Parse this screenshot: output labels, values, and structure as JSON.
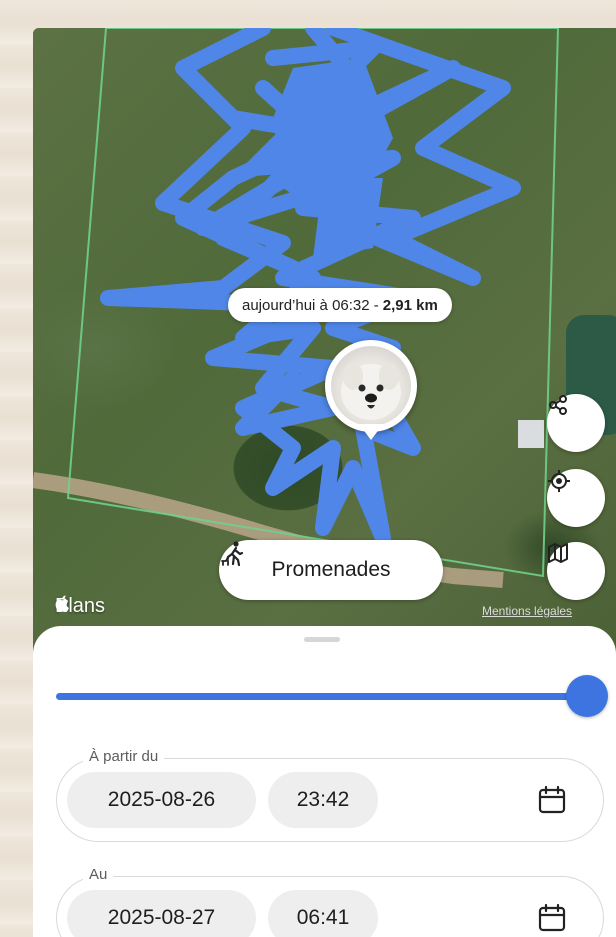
{
  "map": {
    "route_label": {
      "time_text": "aujourd’hui à 06:32 - ",
      "distance": "2,91 km"
    },
    "route_color": "#4f86e8",
    "geofence_color": "#6fd08c",
    "walks_button": {
      "label": "Promenades",
      "icon": "person-walking-dog-icon"
    },
    "side_buttons": [
      {
        "name": "share",
        "icon": "share-icon"
      },
      {
        "name": "locate",
        "icon": "target-icon"
      },
      {
        "name": "map-type",
        "icon": "map-icon"
      }
    ],
    "brand": "Plans",
    "legal": "Mentions légales"
  },
  "sheet": {
    "slider": {
      "value": 1.0,
      "color": "#3d74e0"
    },
    "from": {
      "label": "À partir du",
      "date": "2025-08-26",
      "time": "23:42"
    },
    "to": {
      "label": "Au",
      "date": "2025-08-27",
      "time": "06:41"
    }
  }
}
